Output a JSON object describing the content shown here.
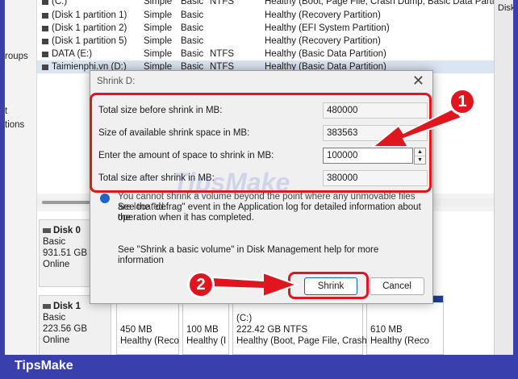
{
  "volume_list": {
    "rows": [
      {
        "name": "(C:)",
        "layout": "Simple",
        "type": "Basic",
        "fs": "NTFS",
        "status": "Healthy (Boot, Page File, Crash Dump, Basic Data Partition)"
      },
      {
        "name": "(Disk 1 partition 1)",
        "layout": "Simple",
        "type": "Basic",
        "fs": "",
        "status": "Healthy (Recovery Partition)"
      },
      {
        "name": "(Disk 1 partition 2)",
        "layout": "Simple",
        "type": "Basic",
        "fs": "",
        "status": "Healthy (EFI System Partition)"
      },
      {
        "name": "(Disk 1 partition 5)",
        "layout": "Simple",
        "type": "Basic",
        "fs": "",
        "status": "Healthy (Recovery Partition)"
      },
      {
        "name": "DATA (E:)",
        "layout": "Simple",
        "type": "Basic",
        "fs": "NTFS",
        "status": "Healthy (Basic Data Partition)"
      },
      {
        "name": "Taimienphi.vn (D:)",
        "layout": "Simple",
        "type": "Basic",
        "fs": "NTFS",
        "status": "Healthy (Basic Data Partition)"
      }
    ]
  },
  "left_strip": {
    "groups": "roups",
    "t": "t",
    "actions": "tions"
  },
  "right_strip": {
    "label": "Disk"
  },
  "disks": [
    {
      "name": "Disk 0",
      "type": "Basic",
      "size": "931.51 GB",
      "status": "Online"
    },
    {
      "name": "Disk 1",
      "type": "Basic",
      "size": "223.56 GB",
      "status": "Online"
    }
  ],
  "partitions": [
    {
      "size": "450 MB",
      "status": "Healthy (Reco"
    },
    {
      "size": "100 MB",
      "status": "Healthy (I"
    },
    {
      "name": "(C:)",
      "size": "222.42 GB NTFS",
      "status": "Healthy (Boot, Page File, Crash"
    },
    {
      "size": "610 MB",
      "status": "Healthy (Reco"
    }
  ],
  "dialog": {
    "title": "Shrink D:",
    "fields": {
      "total_before_label": "Total size before shrink in MB:",
      "total_before_value": "480000",
      "available_label": "Size of available shrink space in MB:",
      "available_value": "383563",
      "amount_label": "Enter the amount of space to shrink in MB:",
      "amount_value": "100000",
      "total_after_label": "Total size after shrink in MB:",
      "total_after_value": "380000"
    },
    "info_line1": "You cannot shrink a volume beyond the point where any unmovable files are located.",
    "info_line2": "See the \"defrag\" event in the Application log for detailed information about the",
    "info_line3": "operation when it has completed.",
    "help_text": "See \"Shrink a basic volume\" in Disk Management help for more information",
    "shrink_label": "Shrink",
    "cancel_label": "Cancel"
  },
  "annotations": {
    "badge1": "1",
    "badge2": "2"
  },
  "watermark": "TipsMake",
  "footer": {
    "brand": "TipsMake"
  },
  "colors": {
    "accent_red": "#e0161f",
    "footer_blue": "#3a3fae",
    "partition_bar": "#1c3f8f"
  }
}
